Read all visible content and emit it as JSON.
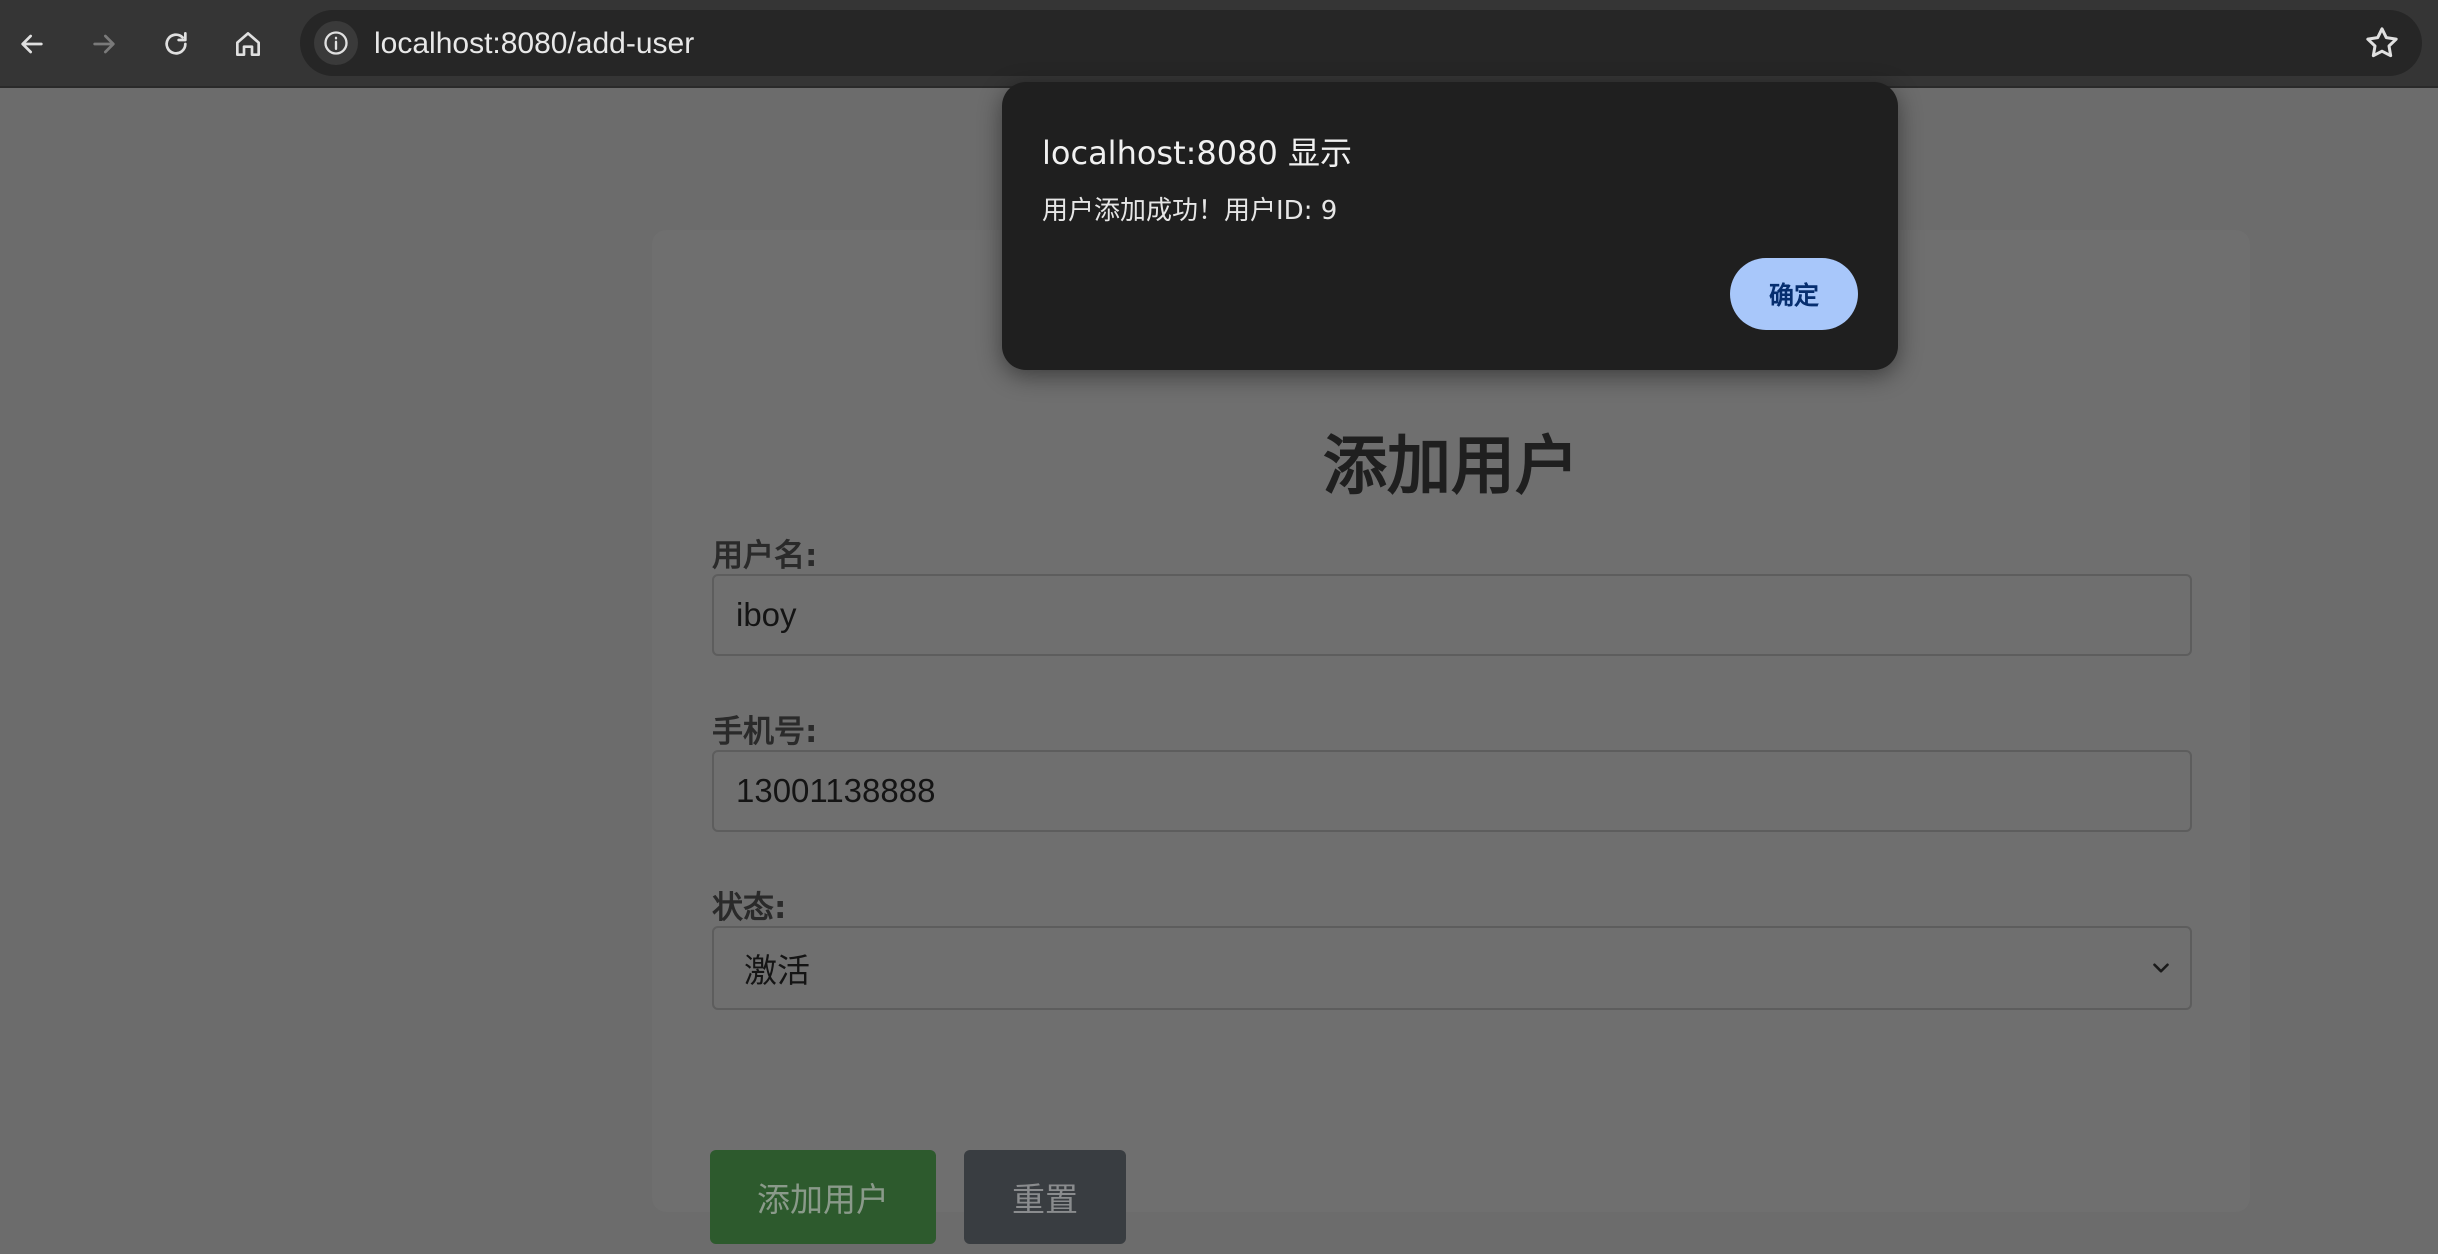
{
  "browser": {
    "url": "localhost:8080/add-user"
  },
  "page": {
    "title": "添加用户",
    "fields": {
      "username_label": "用户名:",
      "username_value": "iboy",
      "phone_label": "手机号:",
      "phone_value": "13001138888",
      "status_label": "状态:",
      "status_value": "激活"
    },
    "buttons": {
      "add_label": "添加用户",
      "reset_label": "重置"
    }
  },
  "dialog": {
    "title": "localhost:8080 显示",
    "message": "用户添加成功！用户ID: 9",
    "ok_label": "确定"
  },
  "icons": {
    "back": "arrow-left-icon",
    "forward": "arrow-right-icon",
    "reload": "reload-icon",
    "home": "home-icon",
    "info": "info-icon",
    "bookmark": "star-icon",
    "select": "chevron-down-icon"
  },
  "colors": {
    "dialog_button": "#a8c7fa",
    "add_button": "#2d5a2d",
    "reset_button": "#393d41"
  }
}
